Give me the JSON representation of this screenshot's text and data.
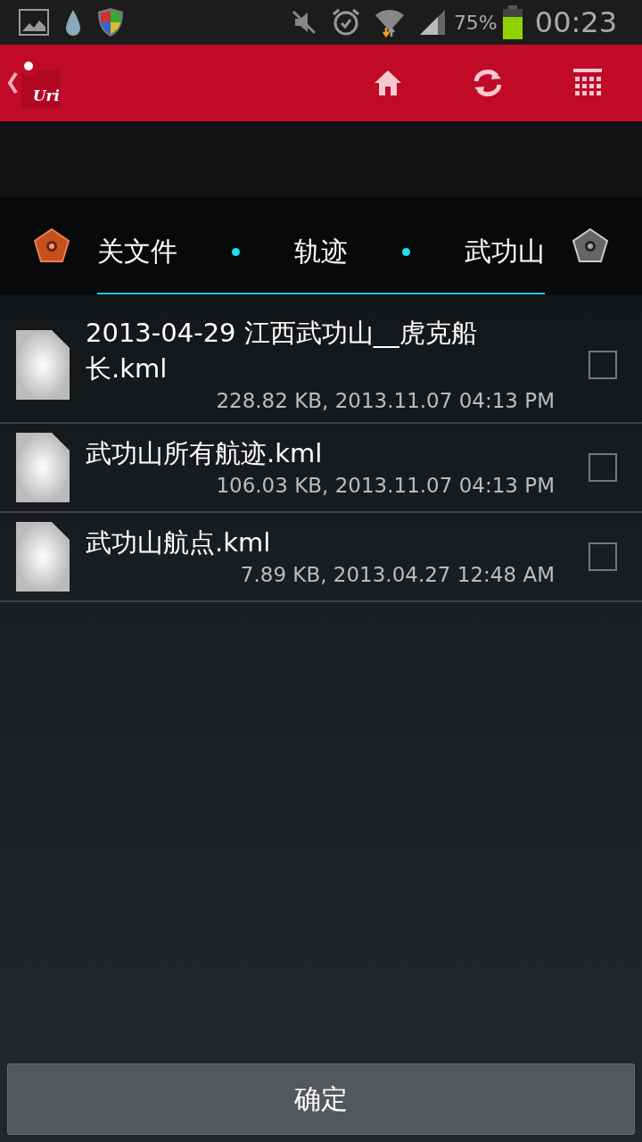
{
  "status_bar": {
    "battery_percent": "75%",
    "time": "00:23",
    "battery": {
      "level": 0.75
    }
  },
  "toolbar": {
    "logo_text": "Uri"
  },
  "breadcrumb": {
    "segments": [
      {
        "label": "关文件"
      },
      {
        "label": "轨迹"
      },
      {
        "label": "武功山"
      }
    ]
  },
  "files": [
    {
      "name": "2013-04-29 江西武功山__虎克船长.kml",
      "meta": "228.82 KB, 2013.11.07 04:13 PM",
      "checked": false
    },
    {
      "name": "武功山所有航迹.kml",
      "meta": "106.03 KB, 2013.11.07 04:13 PM",
      "checked": false
    },
    {
      "name": "武功山航点.kml",
      "meta": "7.89 KB, 2013.04.27 12:48 AM",
      "checked": false
    }
  ],
  "confirm_button": "确定"
}
